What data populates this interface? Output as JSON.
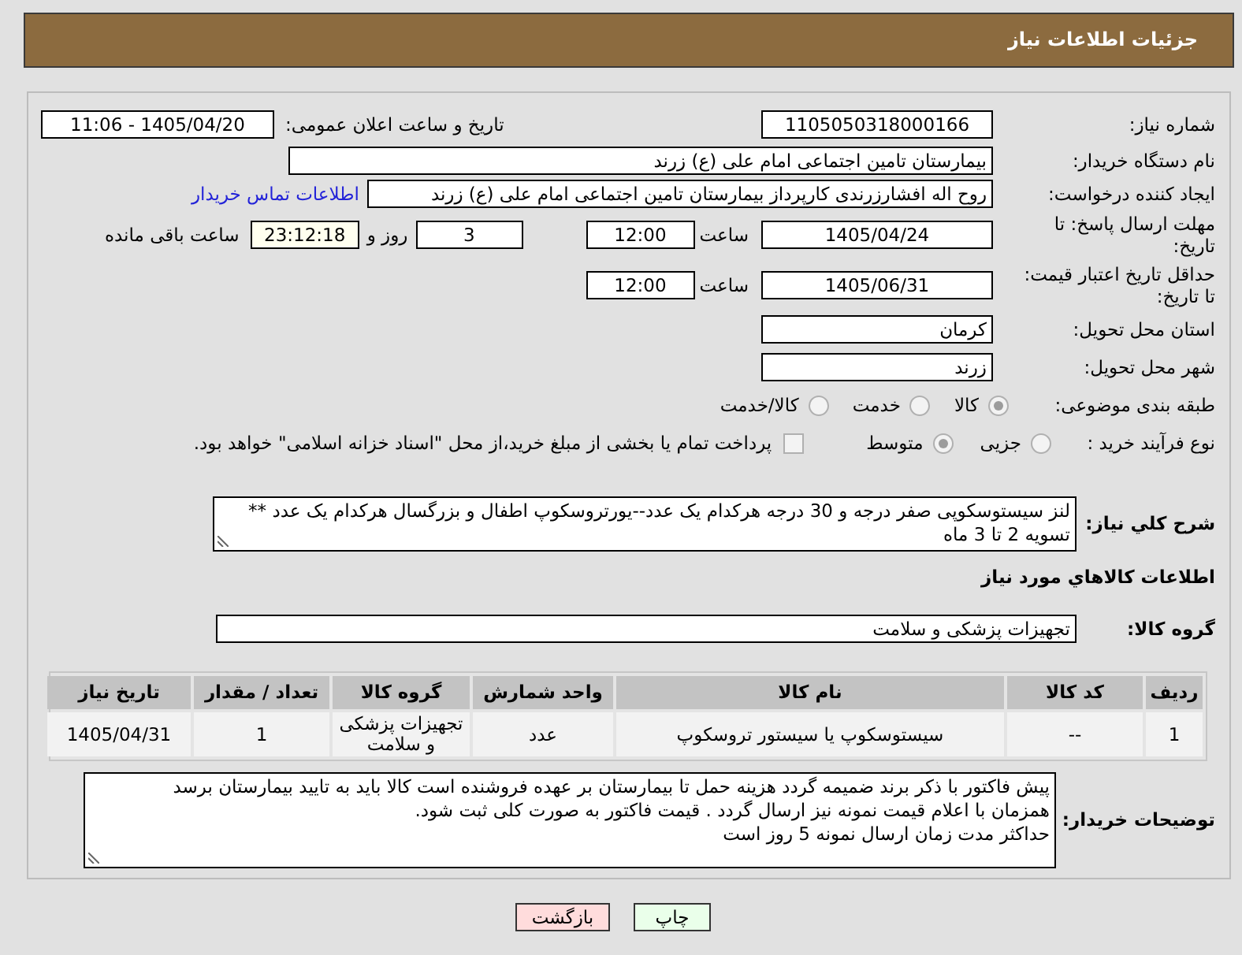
{
  "header": {
    "title": "جزئیات اطلاعات نیاز"
  },
  "need_number": {
    "label": "شماره نیاز:",
    "value": "1105050318000166"
  },
  "announcement": {
    "label": "تاریخ و ساعت اعلان عمومی:",
    "value": "1405/04/20 - 11:06"
  },
  "buyer_org": {
    "label": "نام دستگاه خریدار:",
    "value": "بیمارستان تامین اجتماعی امام علی (ع) زرند"
  },
  "requester": {
    "label": "ایجاد کننده درخواست:",
    "value": "روح اله افشارزرندی کارپرداز بیمارستان تامین اجتماعی امام علی (ع) زرند",
    "contact_link": "اطلاعات تماس خریدار"
  },
  "response_deadline": {
    "label": "مهلت ارسال پاسخ: تا تاریخ:",
    "date": "1405/04/24",
    "time_label": "ساعت",
    "time": "12:00",
    "days": "3",
    "days_label": "روز و",
    "remaining": "23:12:18",
    "remaining_label": "ساعت باقی مانده"
  },
  "price_validity": {
    "label": "حداقل تاریخ اعتبار قیمت: تا تاریخ:",
    "date": "1405/06/31",
    "time_label": "ساعت",
    "time": "12:00"
  },
  "delivery_province": {
    "label": "استان محل تحویل:",
    "value": "کرمان"
  },
  "delivery_city": {
    "label": "شهر محل تحویل:",
    "value": "زرند"
  },
  "subject_category": {
    "label": "طبقه بندی موضوعی:",
    "options": [
      {
        "label": "کالا",
        "selected": true
      },
      {
        "label": "خدمت",
        "selected": false
      },
      {
        "label": "کالا/خدمت",
        "selected": false
      }
    ]
  },
  "purchase_process": {
    "label": "نوع فرآیند خرید :",
    "options": [
      {
        "label": "جزیی",
        "selected": false
      },
      {
        "label": "متوسط",
        "selected": true
      }
    ],
    "treasury_payment": {
      "label": "پرداخت تمام یا بخشی از مبلغ خرید،از محل \"اسناد خزانه اسلامی\" خواهد بود.",
      "checked": false
    }
  },
  "description": {
    "label": "شرح کلي نياز:",
    "value": "لنز سیستوسکوپی صفر درجه و 30 درجه هرکدام یک عدد--یورتروسکوپ اطفال و بزرگسال هرکدام یک عدد ** تسویه 2 تا 3 ماه"
  },
  "goods_section": {
    "title": "اطلاعات کالاهاي مورد نياز"
  },
  "goods_group": {
    "label": "گروه کالا:",
    "value": "تجهیزات پزشکی و سلامت"
  },
  "goods_table": {
    "columns": [
      "ردیف",
      "کد کالا",
      "نام کالا",
      "واحد شمارش",
      "گروه کالا",
      "تعداد / مقدار",
      "تاریخ نیاز"
    ],
    "rows": [
      [
        "1",
        "--",
        "سیستوسکوپ یا سیستور تروسکوپ",
        "عدد",
        "تجهیزات پزشکی و سلامت",
        "1",
        "1405/04/31"
      ]
    ]
  },
  "buyer_notes": {
    "label": "توضیحات خریدار:",
    "value": "پیش فاکتور با ذکر برند ضمیمه گردد هزینه حمل تا بیمارستان بر عهده فروشنده است کالا باید به تایید بیمارستان برسد\nهمزمان با اعلام قیمت نمونه نیز ارسال گردد . قیمت فاکتور به صورت کلی ثبت شود.\nحداکثر مدت زمان ارسال نمونه 5 روز است"
  },
  "buttons": [
    {
      "label": "چاپ",
      "kind": "print"
    },
    {
      "label": "بازگشت",
      "kind": "back"
    }
  ]
}
